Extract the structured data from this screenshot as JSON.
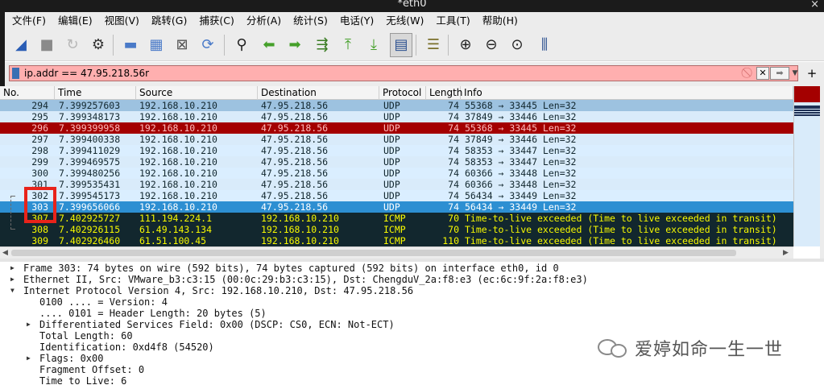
{
  "window": {
    "title": "*eth0",
    "close_glyph": "×"
  },
  "menu": [
    "文件(F)",
    "编辑(E)",
    "视图(V)",
    "跳转(G)",
    "捕获(C)",
    "分析(A)",
    "统计(S)",
    "电话(Y)",
    "无线(W)",
    "工具(T)",
    "帮助(H)"
  ],
  "toolbar": {
    "buttons": [
      {
        "icon": "start-capture-icon",
        "glyph": "◢"
      },
      {
        "icon": "stop-capture-icon",
        "glyph": "■"
      },
      {
        "icon": "restart-capture-icon",
        "glyph": "↻"
      },
      {
        "icon": "capture-options-icon",
        "glyph": "⚙"
      },
      {
        "icon": "open-file-icon",
        "glyph": "▬"
      },
      {
        "icon": "save-file-icon",
        "glyph": "▦"
      },
      {
        "icon": "close-file-icon",
        "glyph": "⊠"
      },
      {
        "icon": "reload-file-icon",
        "glyph": "⟳"
      },
      {
        "icon": "find-packet-icon",
        "glyph": "⚲"
      },
      {
        "icon": "go-back-icon",
        "glyph": "⬅"
      },
      {
        "icon": "go-forward-icon",
        "glyph": "➡"
      },
      {
        "icon": "go-to-packet-icon",
        "glyph": "⇶"
      },
      {
        "icon": "go-first-icon",
        "glyph": "⤒"
      },
      {
        "icon": "go-last-icon",
        "glyph": "⤓"
      },
      {
        "icon": "autoscroll-icon",
        "glyph": "▤"
      },
      {
        "icon": "colorize-icon",
        "glyph": "☰"
      },
      {
        "icon": "zoom-in-icon",
        "glyph": "⊕"
      },
      {
        "icon": "zoom-out-icon",
        "glyph": "⊖"
      },
      {
        "icon": "zoom-reset-icon",
        "glyph": "⊙"
      },
      {
        "icon": "resize-columns-icon",
        "glyph": "⫼"
      }
    ]
  },
  "filter": {
    "value": "ip.addr == 47.95.218.56r",
    "clear_glyph": "⃠",
    "x_glyph": "✕",
    "apply_glyph": "➡",
    "dropdown_glyph": "▼",
    "add_glyph": "+"
  },
  "columns": [
    "No.",
    "Time",
    "Source",
    "Destination",
    "Protocol",
    "Length",
    "Info"
  ],
  "packets": [
    {
      "no": "294",
      "time": "7.399257603",
      "src": "192.168.10.210",
      "dst": "47.95.218.56",
      "proto": "UDP",
      "len": "74",
      "info": "55368 → 33445 Len=32",
      "style": "udp-top"
    },
    {
      "no": "295",
      "time": "7.399348173",
      "src": "192.168.10.210",
      "dst": "47.95.218.56",
      "proto": "UDP",
      "len": "74",
      "info": "37849 → 33446 Len=32",
      "style": "udp"
    },
    {
      "no": "296",
      "time": "7.399399958",
      "src": "192.168.10.210",
      "dst": "47.95.218.56",
      "proto": "UDP",
      "len": "74",
      "info": "55368 → 33445 Len=32",
      "style": "marked"
    },
    {
      "no": "297",
      "time": "7.399400338",
      "src": "192.168.10.210",
      "dst": "47.95.218.56",
      "proto": "UDP",
      "len": "74",
      "info": "37849 → 33446 Len=32",
      "style": "udp"
    },
    {
      "no": "298",
      "time": "7.399411029",
      "src": "192.168.10.210",
      "dst": "47.95.218.56",
      "proto": "UDP",
      "len": "74",
      "info": "58353 → 33447 Len=32",
      "style": "udp alt"
    },
    {
      "no": "299",
      "time": "7.399469575",
      "src": "192.168.10.210",
      "dst": "47.95.218.56",
      "proto": "UDP",
      "len": "74",
      "info": "58353 → 33447 Len=32",
      "style": "udp"
    },
    {
      "no": "300",
      "time": "7.399480256",
      "src": "192.168.10.210",
      "dst": "47.95.218.56",
      "proto": "UDP",
      "len": "74",
      "info": "60366 → 33448 Len=32",
      "style": "udp alt"
    },
    {
      "no": "301",
      "time": "7.399535431",
      "src": "192.168.10.210",
      "dst": "47.95.218.56",
      "proto": "UDP",
      "len": "74",
      "info": "60366 → 33448 Len=32",
      "style": "udp"
    },
    {
      "no": "302",
      "time": "7.399545173",
      "src": "192.168.10.210",
      "dst": "47.95.218.56",
      "proto": "UDP",
      "len": "74",
      "info": "56434 → 33449 Len=32",
      "style": "udp alt"
    },
    {
      "no": "303",
      "time": "7.399656066",
      "src": "192.168.10.210",
      "dst": "47.95.218.56",
      "proto": "UDP",
      "len": "74",
      "info": "56434 → 33449 Len=32",
      "style": "selected"
    },
    {
      "no": "307",
      "time": "7.402925727",
      "src": "111.194.224.1",
      "dst": "192.168.10.210",
      "proto": "ICMP",
      "len": "70",
      "info": "Time-to-live exceeded (Time to live exceeded in transit)",
      "style": "icmp"
    },
    {
      "no": "308",
      "time": "7.402926115",
      "src": "61.49.143.134",
      "dst": "192.168.10.210",
      "proto": "ICMP",
      "len": "70",
      "info": "Time-to-live exceeded (Time to live exceeded in transit)",
      "style": "icmp"
    },
    {
      "no": "309",
      "time": "7.402926460",
      "src": "61.51.100.45",
      "dst": "192.168.10.210",
      "proto": "ICMP",
      "len": "110",
      "info": "Time-to-live exceeded (Time to live exceeded in transit)",
      "style": "icmp"
    }
  ],
  "details": [
    {
      "text": "Frame 303: 74 bytes on wire (592 bits), 74 bytes captured (592 bits) on interface eth0, id 0",
      "indent": 0,
      "arrow": "▶"
    },
    {
      "text": "Ethernet II, Src: VMware_b3:c3:15 (00:0c:29:b3:c3:15), Dst: ChengduV_2a:f8:e3 (ec:6c:9f:2a:f8:e3)",
      "indent": 0,
      "arrow": "▶"
    },
    {
      "text": "Internet Protocol Version 4, Src: 192.168.10.210, Dst: 47.95.218.56",
      "indent": 0,
      "arrow": "▼"
    },
    {
      "text": "0100 .... = Version: 4",
      "indent": 1,
      "arrow": ""
    },
    {
      "text": ".... 0101 = Header Length: 20 bytes (5)",
      "indent": 1,
      "arrow": ""
    },
    {
      "text": "Differentiated Services Field: 0x00 (DSCP: CS0, ECN: Not-ECT)",
      "indent": 1,
      "arrow": "▶"
    },
    {
      "text": "Total Length: 60",
      "indent": 1,
      "arrow": ""
    },
    {
      "text": "Identification: 0xd4f8 (54520)",
      "indent": 1,
      "arrow": ""
    },
    {
      "text": "Flags: 0x00",
      "indent": 1,
      "arrow": "▶"
    },
    {
      "text": "Fragment Offset: 0",
      "indent": 1,
      "arrow": ""
    },
    {
      "text": "Time to Live: 6",
      "indent": 1,
      "arrow": ""
    }
  ],
  "watermark": {
    "text": "爱婷如命一生一世"
  },
  "colors": {
    "marked": "#a40000",
    "selected": "#2d8fd2",
    "udp": "#d9ebfa",
    "icmp_bg": "#12272e",
    "icmp_fg": "#f7f900",
    "filter_invalid": "#ffafaf",
    "annotation_box": "#e8231a"
  }
}
